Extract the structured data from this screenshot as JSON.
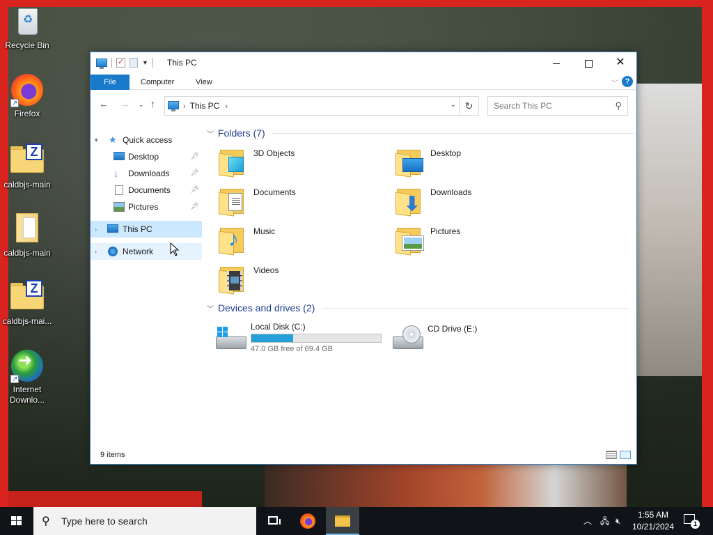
{
  "desktop": {
    "icons": [
      {
        "label": "Recycle Bin",
        "icon": "recycle-bin-icon"
      },
      {
        "label": "Firefox",
        "icon": "firefox-icon"
      },
      {
        "label": "caldbjs-main",
        "icon": "zip-folder-icon"
      },
      {
        "label": "caldbjs-main",
        "icon": "folder-icon"
      },
      {
        "label": "caldbjs-mai...",
        "icon": "zip-folder-icon"
      },
      {
        "label": "Internet Downlo...",
        "icon": "internet-download-manager-icon"
      }
    ]
  },
  "window": {
    "title": "This PC",
    "controls": {
      "minimize": "minimize",
      "maximize": "maximize",
      "close": "✕"
    },
    "ribbon": {
      "tabs": [
        "File",
        "Computer",
        "View"
      ],
      "help": "?"
    },
    "address": {
      "crumb": "This PC",
      "search_placeholder": "Search This PC"
    },
    "sidebar": {
      "quick_access": "Quick access",
      "pinned": [
        "Desktop",
        "Downloads",
        "Documents",
        "Pictures"
      ],
      "this_pc": "This PC",
      "network": "Network"
    },
    "folders": {
      "header": "Folders (7)",
      "items": [
        "3D Objects",
        "Desktop",
        "Documents",
        "Downloads",
        "Music",
        "Pictures",
        "Videos"
      ]
    },
    "drives": {
      "header": "Devices and drives (2)",
      "items": [
        {
          "name": "Local Disk (C:)",
          "free_text": "47.0 GB free of 69.4 GB",
          "used_fraction": 0.32
        },
        {
          "name": "CD Drive (E:)"
        }
      ]
    },
    "status": {
      "items_count": "9 items"
    }
  },
  "taskbar": {
    "search_text": "Type here to search",
    "time": "1:55 AM",
    "date": "10/21/2024",
    "notification_count": "1"
  },
  "colors": {
    "accent": "#1979ca",
    "selected": "#cce8ff",
    "drive_fill": "#26a0da",
    "wallpaper_border": "#d8231f",
    "taskbar": "#101418"
  }
}
